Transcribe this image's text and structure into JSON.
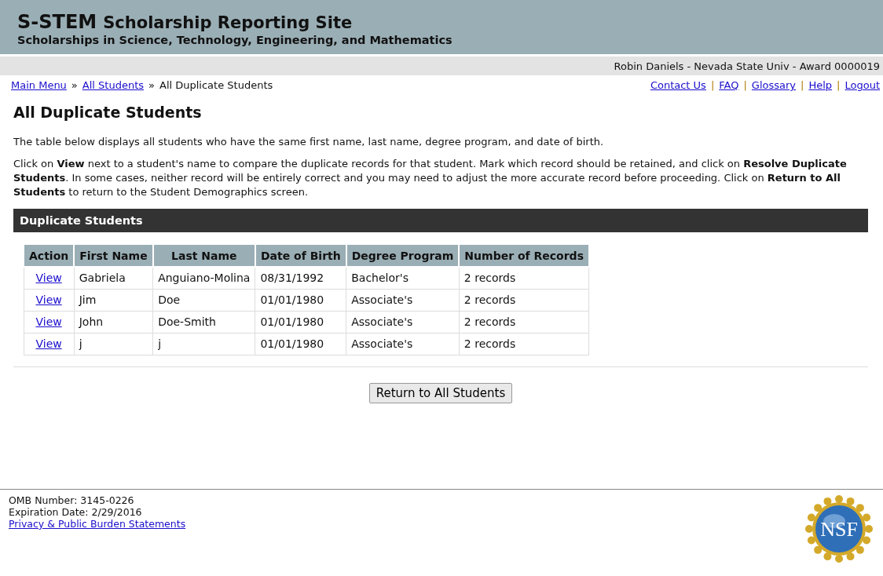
{
  "header": {
    "acronym": "S-STEM",
    "title": "Scholarship Reporting Site",
    "subtitle": "Scholarships in Science, Technology, Engineering, and Mathematics"
  },
  "user_bar": "Robin Daniels - Nevada State Univ - Award 0000019",
  "breadcrumb": [
    {
      "label": "Main Menu",
      "link": true
    },
    {
      "label": "All Students",
      "link": true
    },
    {
      "label": "All Duplicate Students",
      "link": false
    }
  ],
  "breadcrumb_separator": "»",
  "top_links": [
    "Contact Us",
    "FAQ",
    "Glossary",
    "Help",
    "Logout"
  ],
  "link_separator": "|",
  "page_title": "All Duplicate Students",
  "paragraphs": [
    "The table below displays all students who have the same first name, last name, degree program, and date of birth.",
    "Click on **View** next to a student's name to compare the duplicate records for that student. Mark which record should be retained, and click on **Resolve Duplicate Students**. In some cases, neither record will be entirely correct and you may need to adjust the more accurate record before proceeding. Click on **Return to All Students** to return to the Student Demographics screen."
  ],
  "section_title": "Duplicate Students",
  "table": {
    "columns": [
      "Action",
      "First Name",
      "Last Name",
      "Date of Birth",
      "Degree Program",
      "Number of Records"
    ],
    "rows": [
      {
        "action": "View",
        "first_name": "Gabriela",
        "last_name": "Anguiano-Molina",
        "dob": "08/31/1992",
        "degree": "Bachelor's",
        "records": "2 records"
      },
      {
        "action": "View",
        "first_name": "Jim",
        "last_name": "Doe",
        "dob": "01/01/1980",
        "degree": "Associate's",
        "records": "2 records"
      },
      {
        "action": "View",
        "first_name": "John",
        "last_name": "Doe-Smith",
        "dob": "01/01/1980",
        "degree": "Associate's",
        "records": "2 records"
      },
      {
        "action": "View",
        "first_name": "j",
        "last_name": "j",
        "dob": "01/01/1980",
        "degree": "Associate's",
        "records": "2 records"
      }
    ]
  },
  "return_button": "Return to All Students",
  "footer": {
    "lines": [
      "OMB Number: 3145-0226",
      "Expiration Date: 2/29/2016"
    ],
    "link": "Privacy & Public Burden Statements",
    "logo_text": "NSF"
  }
}
